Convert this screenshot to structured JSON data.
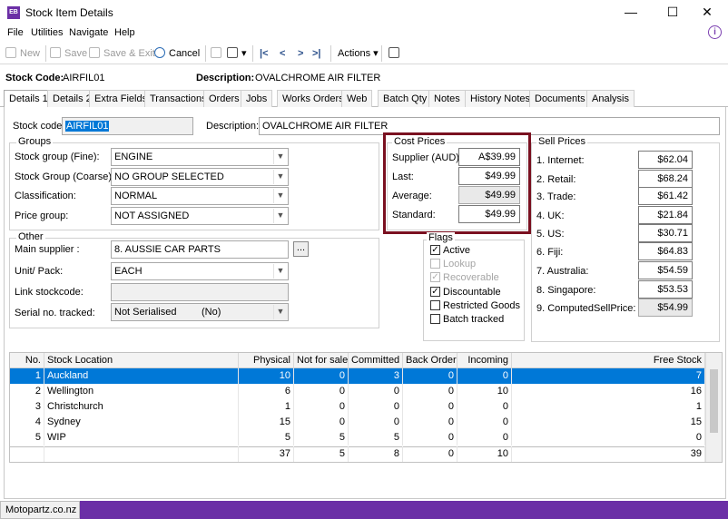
{
  "window": {
    "app_badge": "EB",
    "title": "Stock Item Details",
    "minimize": "—",
    "maximize": "☐",
    "close": "✕"
  },
  "menu": [
    "File",
    "Utilities",
    "Navigate",
    "Help"
  ],
  "toolbar": {
    "new": "New",
    "save": "Save",
    "save_exit": "Save & Exit",
    "cancel": "Cancel",
    "first": "|<",
    "prev": "<",
    "next": ">",
    "last": ">|",
    "actions": "Actions ▾"
  },
  "header": {
    "code_label": "Stock Code:",
    "code_value": "AIRFIL01",
    "desc_label": "Description:",
    "desc_value": "OVALCHROME AIR FILTER"
  },
  "tabs": [
    "Details 1",
    "Details 2",
    "Extra Fields",
    "Transactions",
    "Orders",
    "Jobs",
    "Works Orders",
    "Web",
    "Batch Qty",
    "Notes",
    "History Notes",
    "Documents",
    "Analysis"
  ],
  "fields": {
    "stock_code_label": "Stock code:",
    "stock_code": "AIRFIL01",
    "description_label": "Description:",
    "description": "OVALCHROME AIR FILTER"
  },
  "groups": {
    "title": "Groups",
    "items": [
      {
        "label": "Stock group (Fine):",
        "value": "ENGINE"
      },
      {
        "label": "Stock Group (Coarse):",
        "value": "NO GROUP SELECTED"
      },
      {
        "label": "Classification:",
        "value": "NORMAL"
      },
      {
        "label": "Price group:",
        "value": "NOT ASSIGNED"
      }
    ]
  },
  "other": {
    "title": "Other",
    "main_supplier_label": "Main supplier :",
    "main_supplier": "8. AUSSIE CAR PARTS",
    "unit_label": "Unit/ Pack:",
    "unit": "EACH",
    "link_label": "Link stockcode:",
    "link": "",
    "serial_label": "Serial no. tracked:",
    "serial": "Not Serialised         (No)",
    "browse": "..."
  },
  "cost_prices": {
    "title": "Cost Prices",
    "items": [
      {
        "label": "Supplier (AUD):",
        "value": "A$39.99"
      },
      {
        "label": "Last:",
        "value": "$49.99"
      },
      {
        "label": "Average:",
        "value": "$49.99"
      },
      {
        "label": "Standard:",
        "value": "$49.99"
      }
    ],
    "highlight_color": "#7a1020"
  },
  "flags": {
    "title": "Flags",
    "items": [
      {
        "label": "Active",
        "checked": "✓"
      },
      {
        "label": "Lookup",
        "checked": ""
      },
      {
        "label": "Recoverable",
        "checked": "✓"
      },
      {
        "label": "Discountable",
        "checked": "✓"
      },
      {
        "label": "Restricted Goods",
        "checked": ""
      },
      {
        "label": "Batch tracked",
        "checked": ""
      }
    ]
  },
  "sell_prices": {
    "title": "Sell Prices",
    "items": [
      {
        "label": "1. Internet:",
        "value": "$62.04"
      },
      {
        "label": "2. Retail:",
        "value": "$68.24"
      },
      {
        "label": "3. Trade:",
        "value": "$61.42"
      },
      {
        "label": "4. UK:",
        "value": "$21.84"
      },
      {
        "label": "5. US:",
        "value": "$30.71"
      },
      {
        "label": "6. Fiji:",
        "value": "$64.83"
      },
      {
        "label": "7. Australia:",
        "value": "$54.59"
      },
      {
        "label": "8. Singapore:",
        "value": "$53.53"
      },
      {
        "label": "9. ComputedSellPrice:",
        "value": "$54.99"
      }
    ]
  },
  "locations": {
    "columns": [
      "No.",
      "Stock Location",
      "Physical",
      "Not for sale",
      "Committed",
      "Back Order",
      "Incoming",
      "Free Stock"
    ],
    "rows": [
      [
        "1",
        "Auckland",
        "10",
        "0",
        "3",
        "0",
        "0",
        "7"
      ],
      [
        "2",
        "Wellington",
        "6",
        "0",
        "0",
        "0",
        "10",
        "16"
      ],
      [
        "3",
        "Christchurch",
        "1",
        "0",
        "0",
        "0",
        "0",
        "1"
      ],
      [
        "4",
        "Sydney",
        "15",
        "0",
        "0",
        "0",
        "0",
        "15"
      ],
      [
        "5",
        "WIP",
        "5",
        "5",
        "5",
        "0",
        "0",
        "0"
      ]
    ],
    "totals": [
      "",
      "",
      "37",
      "5",
      "8",
      "0",
      "10",
      "39"
    ]
  },
  "status": {
    "text": "Motopartz.co.nz",
    "bar_color": "#6b2fa6"
  }
}
